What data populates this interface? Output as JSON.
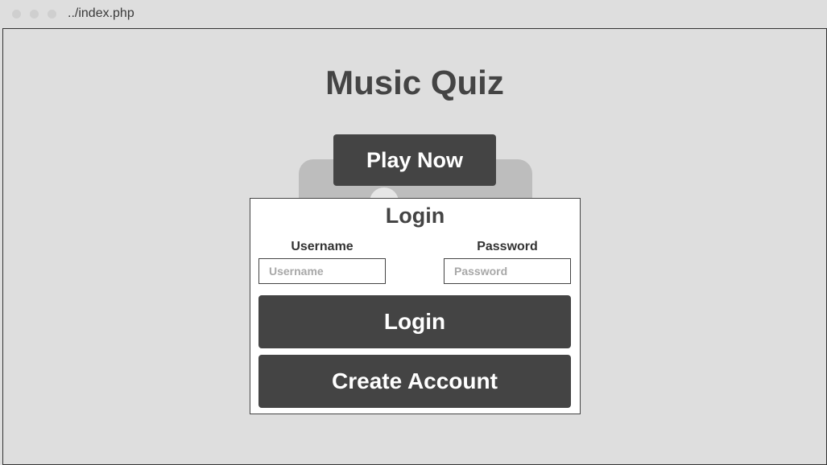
{
  "browser": {
    "url": "../index.php"
  },
  "page": {
    "title": "Music Quiz",
    "play_label": "Play Now"
  },
  "login": {
    "heading": "Login",
    "username_label": "Username",
    "username_placeholder": "Username",
    "password_label": "Password",
    "password_placeholder": "Password",
    "login_label": "Login",
    "create_label": "Create Account"
  }
}
